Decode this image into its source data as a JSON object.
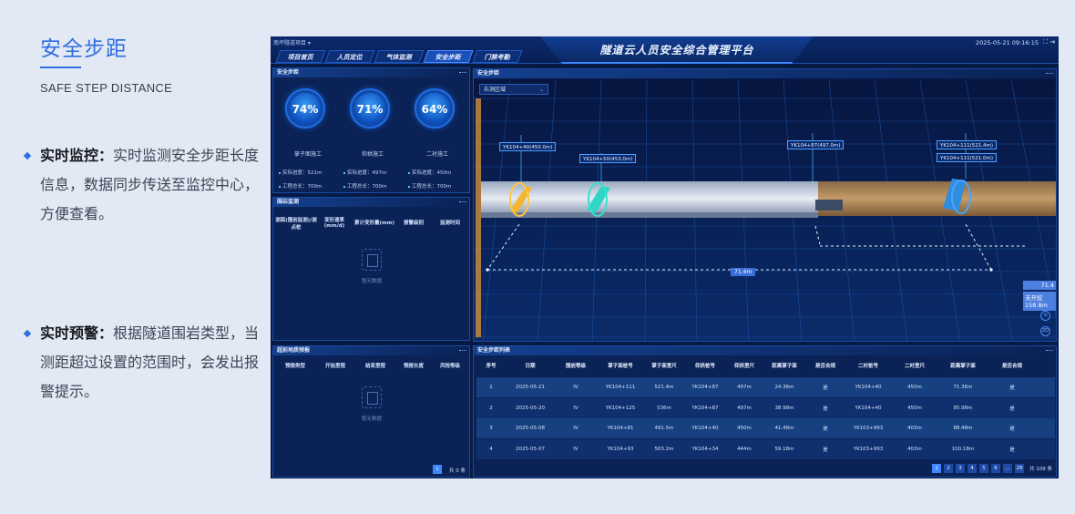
{
  "section": {
    "title": "安全步距",
    "subtitle": "SAFE STEP DISTANCE",
    "features": [
      {
        "head": "实时监控：",
        "body": "实时监测安全步距长度信息，数据同步传送至监控中心，方便查看。"
      },
      {
        "head": "实时预警：",
        "body": "根据隧道围岩类型，当测距超过设置的范围时，会发出报警提示。"
      }
    ]
  },
  "dashboard": {
    "project": "南坪隧道项目 ▾",
    "title": "隧道云人员安全综合管理平台",
    "datetime": "2025-05-21 09:16:15",
    "tabs": [
      "项目首页",
      "人员定位",
      "气体监测",
      "安全步距",
      "门禁考勤"
    ],
    "active_tab": 3,
    "panel_safety": {
      "title": "安全步距",
      "gauges": [
        {
          "value": "74%",
          "label": "掌子面施工"
        },
        {
          "value": "71%",
          "label": "仰拱施工"
        },
        {
          "value": "64%",
          "label": "二衬施工"
        }
      ],
      "stats": [
        [
          "实际进度：521m",
          "实际进度：497m",
          "实际进度：450m"
        ],
        [
          "工程总长：700m",
          "工程总长：700m",
          "工程总长：700m"
        ]
      ]
    },
    "panel_rock": {
      "title": "围岩监测",
      "headers": [
        "测面(围岩监测)/测点桩",
        "变形速率(mm/d)",
        "累计变形量(mm)",
        "报警级别",
        "监测时间"
      ],
      "empty": "暂无数据"
    },
    "panel_geo": {
      "title": "超前地质预报",
      "headers": [
        "预报类型",
        "开始里程",
        "结束里程",
        "预报长度",
        "风险等级"
      ],
      "empty": "暂无数据",
      "page": "1",
      "total": "共 0 条"
    },
    "view3d": {
      "title": "安全步距",
      "dropdown": "右洞区域",
      "tags": [
        "YK104+40(450.0m)",
        "YK104+50(453.0m)",
        "YK104+87(497.0m)",
        "YK104+111(521.4m)",
        "YK104+111(521.0m)"
      ],
      "distance": "71.4m",
      "side_value": "71.4",
      "side_label": "未开挖",
      "side_len": "158.8m",
      "ctrl": [
        "⟲",
        "2D"
      ]
    },
    "step_list": {
      "title": "安全步距列表",
      "headers": [
        "序号",
        "日期",
        "围岩等级",
        "掌子面桩号",
        "掌子面里尺",
        "仰拱桩号",
        "仰拱里尺",
        "距离掌子面",
        "是否合规",
        "二衬桩号",
        "二衬里尺",
        "距离掌子面",
        "是否合规"
      ],
      "rows": [
        [
          "1",
          "2025-05-21",
          "IV",
          "YK104+111",
          "521.4m",
          "YK104+87",
          "497m",
          "24.36m",
          "是",
          "YK104+40",
          "450m",
          "71.36m",
          "是"
        ],
        [
          "2",
          "2025-05-20",
          "IV",
          "YK104+125",
          "536m",
          "YK104+87",
          "497m",
          "38.98m",
          "是",
          "YK104+40",
          "450m",
          "85.98m",
          "是"
        ],
        [
          "3",
          "2025-05-08",
          "IV",
          "YK104+81",
          "491.5m",
          "YK104+40",
          "450m",
          "41.48m",
          "是",
          "YK103+993",
          "403m",
          "88.48m",
          "是"
        ],
        [
          "4",
          "2025-05-07",
          "IV",
          "YK104+93",
          "503.2m",
          "YK104+34",
          "444m",
          "59.18m",
          "是",
          "YK103+993",
          "403m",
          "100.18m",
          "是"
        ]
      ],
      "pages": [
        "1",
        "2",
        "3",
        "4",
        "5",
        "6",
        "...",
        "28"
      ],
      "total": "共 109 条"
    }
  }
}
